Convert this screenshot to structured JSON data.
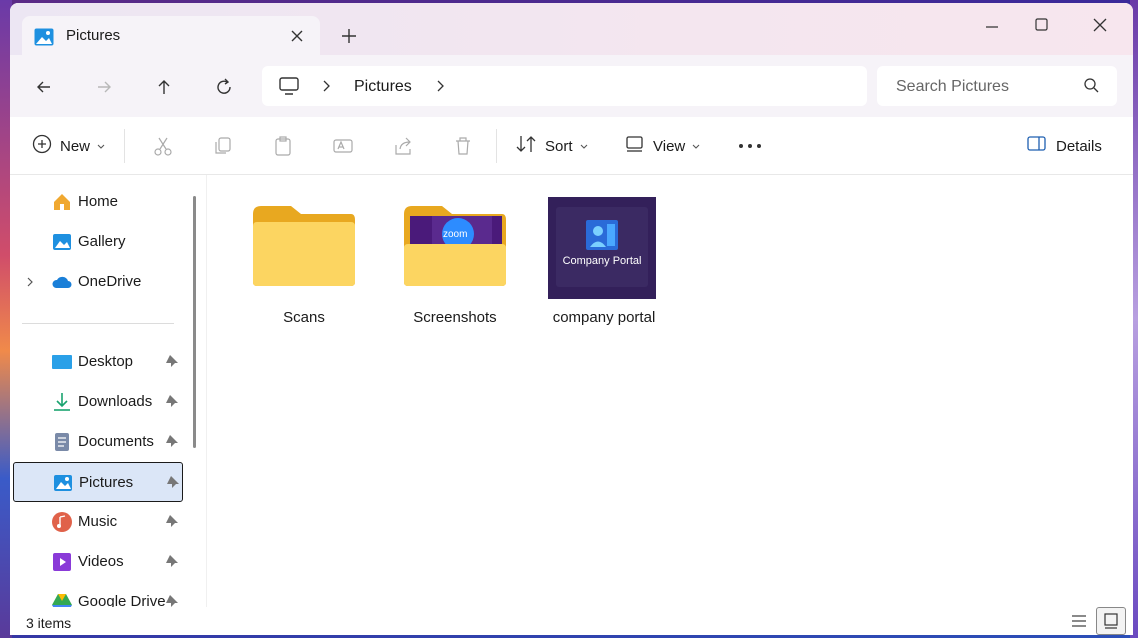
{
  "window": {
    "tab_title": "Pictures"
  },
  "address": {
    "location": "Pictures"
  },
  "search": {
    "placeholder": "Search Pictures"
  },
  "commands": {
    "new": "New",
    "sort": "Sort",
    "view": "View",
    "details": "Details"
  },
  "sidebar": {
    "items": [
      {
        "label": "Home",
        "icon": "home-icon"
      },
      {
        "label": "Gallery",
        "icon": "gallery-icon"
      },
      {
        "label": "OneDrive",
        "icon": "onedrive-icon"
      },
      {
        "label": "Desktop",
        "icon": "desktop-icon"
      },
      {
        "label": "Downloads",
        "icon": "downloads-icon"
      },
      {
        "label": "Documents",
        "icon": "documents-icon"
      },
      {
        "label": "Pictures",
        "icon": "pictures-icon"
      },
      {
        "label": "Music",
        "icon": "music-icon"
      },
      {
        "label": "Videos",
        "icon": "videos-icon"
      },
      {
        "label": "Google Drive",
        "icon": "google-drive-icon"
      }
    ]
  },
  "files": [
    {
      "name": "Scans",
      "type": "folder"
    },
    {
      "name": "Screenshots",
      "type": "folder"
    },
    {
      "name": "company portal",
      "type": "image",
      "thumb_text": "Company Portal"
    }
  ],
  "thumb_badges": {
    "zoom": "zoom"
  },
  "status": {
    "count": "3 items"
  },
  "colors": {
    "accent": "#0067c0",
    "folder": "#f8c93e",
    "portal_bg": "#33205a"
  }
}
